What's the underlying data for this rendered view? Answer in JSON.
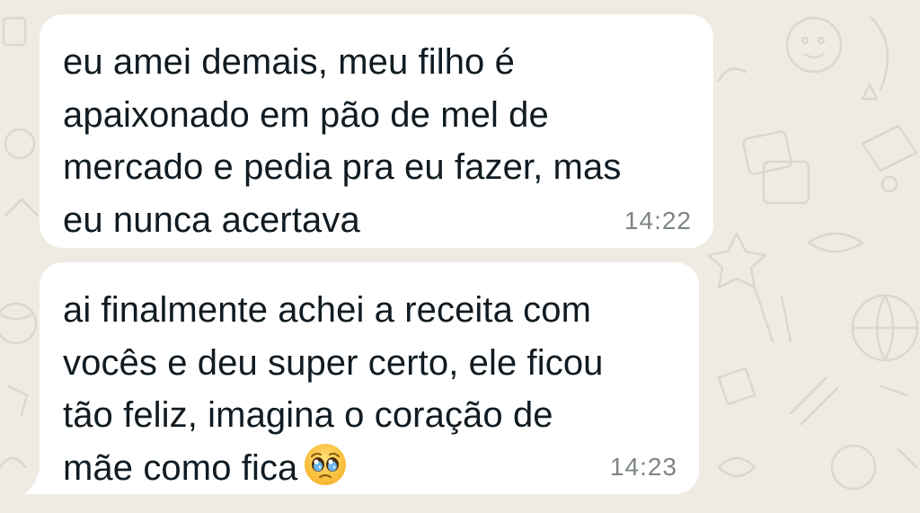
{
  "chat": {
    "wallpaper_color": "#efeae2",
    "bubble_color": "#ffffff",
    "text_color": "#111b21",
    "time_color": "#7d8487"
  },
  "messages": [
    {
      "lines": [
        "eu amei demais, meu filho é",
        "apaixonado em pão de mel de",
        "mercado e pedia pra eu fazer, mas",
        "eu nunca acertava"
      ],
      "time": "14:22"
    },
    {
      "lines": [
        "ai finalmente achei a receita com",
        "vocês e deu super certo, ele ficou",
        "tão feliz, imagina o coração de",
        "mãe como fica"
      ],
      "emoji": "pleading-face-icon",
      "time": "14:23"
    }
  ]
}
